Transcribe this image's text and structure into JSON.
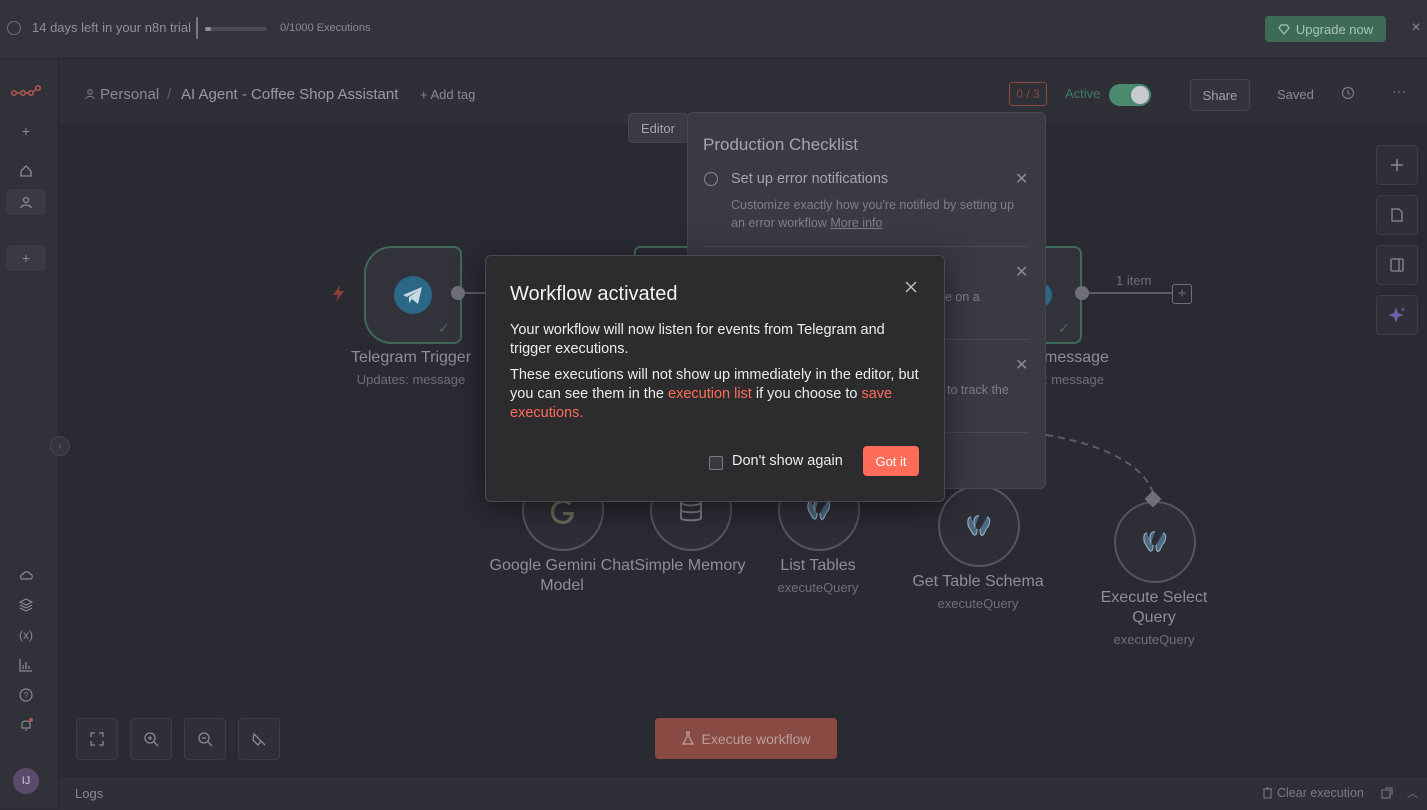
{
  "trial": {
    "text": "14 days left in your n8n trial",
    "executions": "0/1000 Executions",
    "progress_fraction": 0.0,
    "upgrade_label": "Upgrade now"
  },
  "header": {
    "project": "Personal",
    "workflow_name": "AI Agent - Coffee Shop Assistant",
    "add_tag": "+ Add tag",
    "counter": "0 / 3",
    "active_label": "Active",
    "share_label": "Share",
    "saved_label": "Saved"
  },
  "editor_tab": "Editor",
  "checklist": {
    "title": "Production Checklist",
    "item1_title": "Set up error notifications",
    "item1_desc": "Customize exactly how you're notified by setting up an error workflow",
    "item1_link": "More info",
    "item2_partial": "e on a",
    "item3_partial": "to track the"
  },
  "nodes": {
    "telegram_trigger": {
      "label": "Telegram Trigger",
      "sub": "Updates: message"
    },
    "send_message": {
      "label": "message",
      "sub": ": message",
      "items": "1 item"
    },
    "gemini": {
      "label_line1": "Google Gemini Chat",
      "label_line2": "Model"
    },
    "memory": {
      "label": "Simple Memory"
    },
    "list_tables": {
      "label": "List Tables",
      "sub": "executeQuery"
    },
    "table_schema": {
      "label": "Get Table Schema",
      "sub": "executeQuery"
    },
    "select_query": {
      "label_line1": "Execute Select",
      "label_line2": "Query",
      "sub": "executeQuery"
    }
  },
  "execute_label": "Execute workflow",
  "logs": {
    "label": "Logs",
    "clear_label": "Clear execution"
  },
  "user_initials": "IJ",
  "modal": {
    "title": "Workflow activated",
    "p1": "Your workflow will now listen for events from Telegram and trigger executions.",
    "p2_a": "These executions will not show up immediately in the editor, but you can see them in the ",
    "p2_link1": "execution list",
    "p2_b": " if you choose to ",
    "p2_link2": "save executions.",
    "dont_show": "Don't show again",
    "got_it": "Got it"
  },
  "colors": {
    "accent": "#ff6d5a",
    "active_green": "#4b8a6e"
  }
}
